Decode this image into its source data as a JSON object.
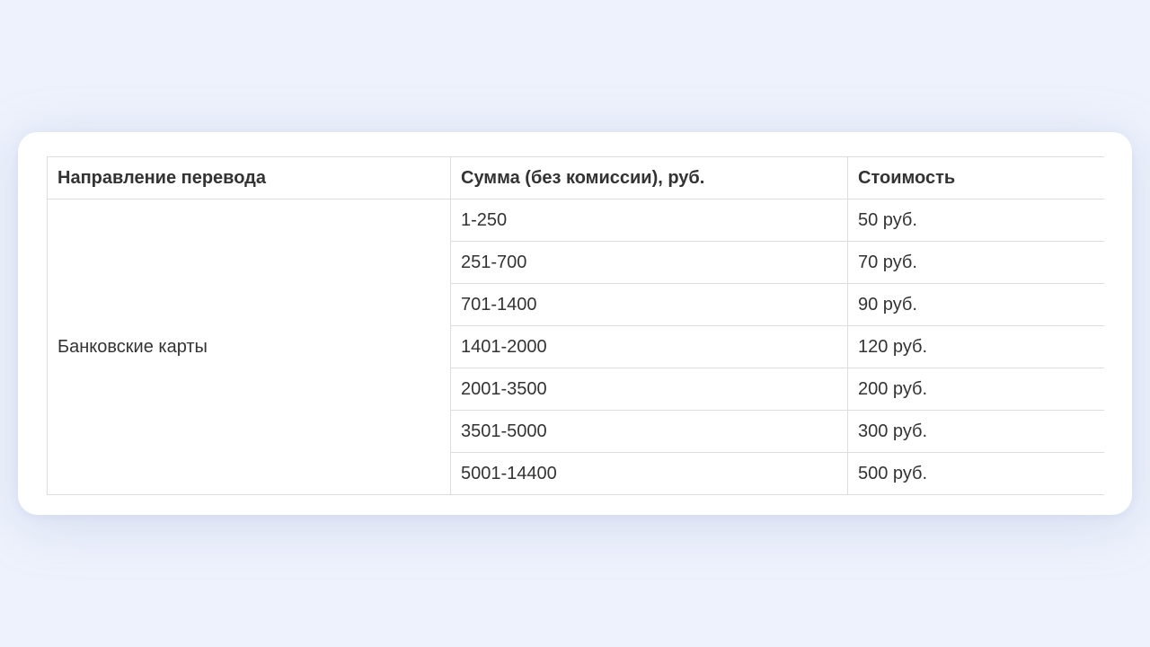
{
  "table": {
    "headers": [
      "Направление перевода",
      "Сумма (без комиссии), руб.",
      "Стоимость"
    ],
    "direction": "Банковские карты",
    "rows": [
      {
        "range": "1-250",
        "price": "50 руб."
      },
      {
        "range": "251-700",
        "price": "70 руб."
      },
      {
        "range": "701-1400",
        "price": "90 руб."
      },
      {
        "range": "1401-2000",
        "price": "120 руб."
      },
      {
        "range": "2001-3500",
        "price": "200 руб."
      },
      {
        "range": "3501-5000",
        "price": "300 руб."
      },
      {
        "range": "5001-14400",
        "price": "500 руб."
      }
    ]
  }
}
